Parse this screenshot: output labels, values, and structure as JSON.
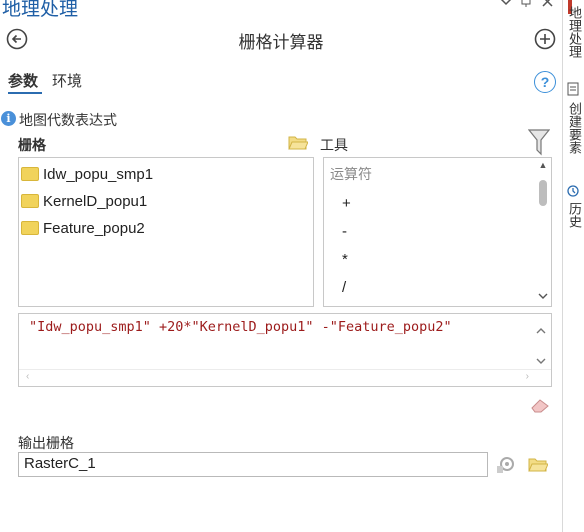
{
  "panel": {
    "title": "地理处理"
  },
  "tool": {
    "title": "栅格计算器"
  },
  "tabs": [
    {
      "label": "参数",
      "active": true
    },
    {
      "label": "环境",
      "active": false
    }
  ],
  "help_symbol": "?",
  "section": {
    "label": "地图代数表达式"
  },
  "rasters": {
    "header": "栅格",
    "items": [
      "Idw_popu_smp1",
      "KernelD_popu1",
      "Feature_popu2"
    ]
  },
  "tools": {
    "header": "工具",
    "placeholder": "运算符",
    "operators": [
      "+",
      "-",
      "*",
      "/"
    ]
  },
  "expression": {
    "value": "\"Idw_popu_smp1\" +20*\"KernelD_popu1\" -\"Feature_popu2\""
  },
  "output": {
    "label": "输出栅格",
    "value": "RasterC_1"
  },
  "right_tabs": [
    "地理处理",
    "创建要素",
    "历史"
  ],
  "colors": {
    "accent": "#1f5fa6",
    "expression_text": "#9c1b1b",
    "folder": "#f1d35b",
    "info": "#4a90d9"
  }
}
